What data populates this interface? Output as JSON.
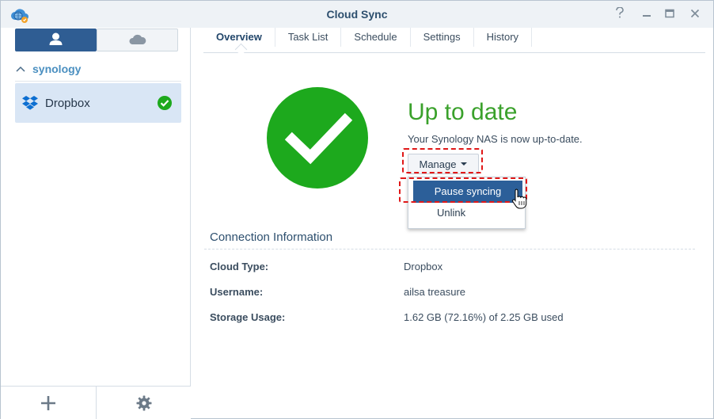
{
  "window": {
    "title": "Cloud Sync"
  },
  "sidebar": {
    "group_label": "synology",
    "accounts": [
      {
        "label": "Dropbox",
        "status": "synced"
      }
    ]
  },
  "tabs": [
    {
      "label": "Overview",
      "active": true
    },
    {
      "label": "Task List",
      "active": false
    },
    {
      "label": "Schedule",
      "active": false
    },
    {
      "label": "Settings",
      "active": false
    },
    {
      "label": "History",
      "active": false
    }
  ],
  "status": {
    "title": "Up to date",
    "description": "Your Synology NAS is now up-to-date."
  },
  "manage": {
    "label": "Manage",
    "menu": [
      {
        "label": "Pause syncing",
        "highlighted": true
      },
      {
        "label": "Unlink",
        "highlighted": false
      }
    ]
  },
  "connection": {
    "title": "Connection Information",
    "rows": [
      {
        "label": "Cloud Type:",
        "value": "Dropbox"
      },
      {
        "label": "Username:",
        "value": "ailsa treasure"
      },
      {
        "label": "Storage Usage:",
        "value": "1.62 GB (72.16%) of 2.25 GB used"
      }
    ]
  },
  "colors": {
    "accent_blue": "#2f5d93",
    "success_green": "#1da91d",
    "annotation_red": "#e01818"
  },
  "icons": [
    "cloud-sync-app-icon",
    "help-icon",
    "minimize-icon",
    "maximize-icon",
    "close-icon",
    "user-icon",
    "cloud-icon",
    "chevron-up-icon",
    "dropbox-icon",
    "check-badge-icon",
    "add-icon",
    "gear-icon",
    "checkmark-icon",
    "pointer-cursor-icon"
  ]
}
